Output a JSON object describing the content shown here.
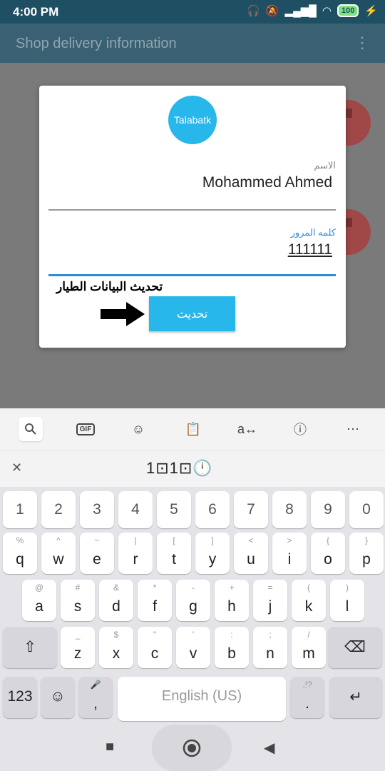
{
  "status_bar": {
    "time": "4:00 PM",
    "battery": "100"
  },
  "app_bar": {
    "title": "Shop delivery information"
  },
  "dialog": {
    "logo_text": "Talabatk",
    "name_label": "الاسم",
    "name_value": "Mohammed Ahmed",
    "password_label": "كلمه المرور",
    "password_value": "111111",
    "annotation": "تحديث البيانات الطيار",
    "update_button": "تحديث"
  },
  "keyboard": {
    "toolbar": [
      "search-icon",
      "gif-icon",
      "sticker-icon",
      "clipboard-icon",
      "translate-icon",
      "info-icon",
      "more-icon"
    ],
    "gif_label": "GIF",
    "suggestion": "1⊡1⊡🕛",
    "number_row": [
      "1",
      "2",
      "3",
      "4",
      "5",
      "6",
      "7",
      "8",
      "9",
      "0"
    ],
    "row1": [
      {
        "k": "q",
        "s": "%"
      },
      {
        "k": "w",
        "s": "^"
      },
      {
        "k": "e",
        "s": "~"
      },
      {
        "k": "r",
        "s": "|"
      },
      {
        "k": "t",
        "s": "["
      },
      {
        "k": "y",
        "s": "]"
      },
      {
        "k": "u",
        "s": "<"
      },
      {
        "k": "i",
        "s": ">"
      },
      {
        "k": "o",
        "s": "{"
      },
      {
        "k": "p",
        "s": "}"
      }
    ],
    "row2": [
      {
        "k": "a",
        "s": "@"
      },
      {
        "k": "s",
        "s": "#"
      },
      {
        "k": "d",
        "s": "&"
      },
      {
        "k": "f",
        "s": "*"
      },
      {
        "k": "g",
        "s": "-"
      },
      {
        "k": "h",
        "s": "+"
      },
      {
        "k": "j",
        "s": "="
      },
      {
        "k": "k",
        "s": "("
      },
      {
        "k": "l",
        "s": ")"
      }
    ],
    "row3": [
      {
        "k": "z",
        "s": "_"
      },
      {
        "k": "x",
        "s": "$"
      },
      {
        "k": "c",
        "s": "\""
      },
      {
        "k": "v",
        "s": "'"
      },
      {
        "k": "b",
        "s": ":"
      },
      {
        "k": "n",
        "s": ";"
      },
      {
        "k": "m",
        "s": "/"
      }
    ],
    "key_123": "123",
    "comma": ",",
    "space_label": "English (US)",
    "period": ".",
    "period_sub": ",!?"
  }
}
